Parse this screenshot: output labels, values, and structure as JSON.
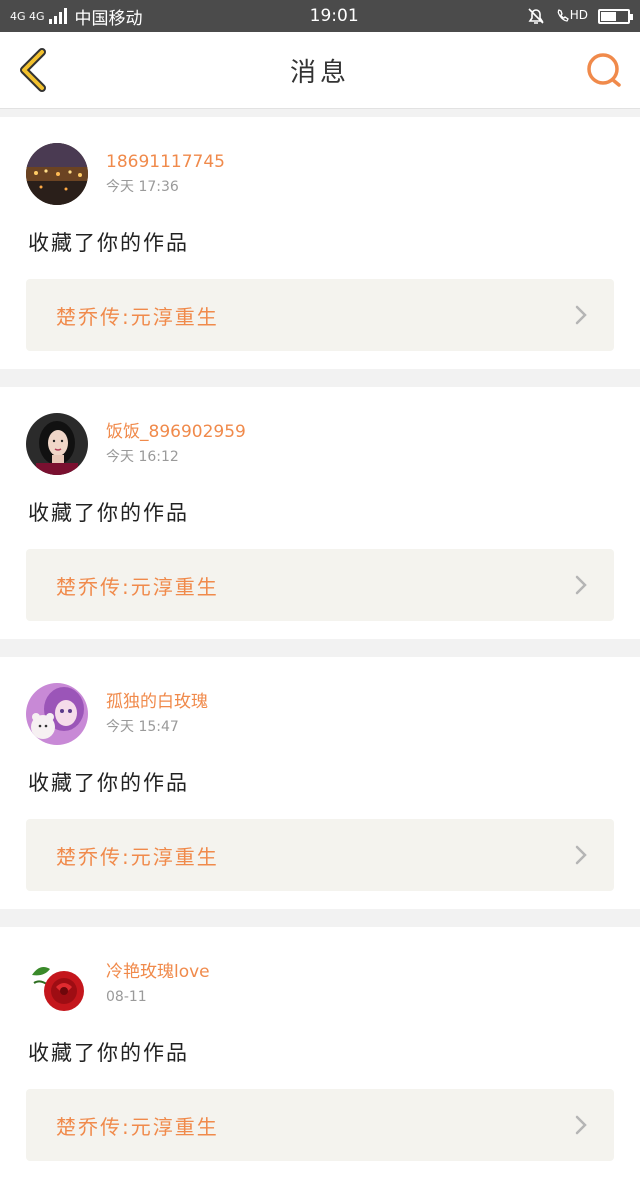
{
  "status_bar": {
    "network": "4G 4G",
    "carrier": "中国移动",
    "time": "19:01",
    "hd": "HD"
  },
  "header": {
    "title": "消息"
  },
  "messages": [
    {
      "name": "18691117745",
      "time": "今天 17:36",
      "text": "收藏了你的作品",
      "work": "楚乔传:元淳重生",
      "avatar": "night-city-avatar"
    },
    {
      "name": "饭饭_896902959",
      "time": "今天 16:12",
      "text": "收藏了你的作品",
      "work": "楚乔传:元淳重生",
      "avatar": "woman-portrait-avatar"
    },
    {
      "name": "孤独的白玫瑰",
      "time": "今天 15:47",
      "text": "收藏了你的作品",
      "work": "楚乔传:元淳重生",
      "avatar": "doll-avatar"
    },
    {
      "name": "冷艳玫瑰love",
      "time": "08-11",
      "text": "收藏了你的作品",
      "work": "楚乔传:元淳重生",
      "avatar": "red-rose-avatar"
    }
  ],
  "colors": {
    "accent": "#f08a4b",
    "back_icon": "#f2c12e",
    "status_bar": "#4b4b4b"
  }
}
